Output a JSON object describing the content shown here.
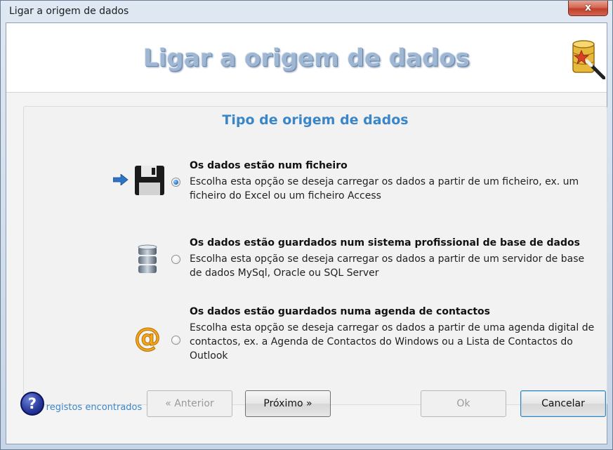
{
  "window": {
    "title": "Ligar a origem de dados",
    "close_symbol": "x"
  },
  "banner": {
    "title": "Ligar a origem de dados",
    "icon": "database-wizard-icon"
  },
  "section": {
    "title": "Tipo de origem de dados"
  },
  "options": [
    {
      "title": "Os dados estão num ficheiro",
      "description": "Escolha esta opção se deseja carregar os dados a partir de um ficheiro, ex. um ficheiro do Excel ou um ficheiro Access",
      "icon": "floppy-disk-icon",
      "selected": true
    },
    {
      "title": "Os dados estão guardados num sistema profissional de base de dados",
      "description": "Escolha esta opção se deseja carregar os dados a partir de um servidor de base de dados MySql, Oracle ou SQL Server",
      "icon": "database-icon",
      "selected": false
    },
    {
      "title": "Os dados estão guardados numa agenda de contactos",
      "description": "Escolha esta opção se deseja carregar os dados a partir de uma agenda digital de contactos, ex. a Agenda de Contactos do Windows ou a Lista de Contactos do Outlook",
      "icon": "at-sign-icon",
      "selected": false
    }
  ],
  "status": "11 registos encontrados",
  "buttons": {
    "help": "?",
    "previous": "« Anterior",
    "next": "Próximo »",
    "ok": "Ok",
    "cancel": "Cancelar"
  },
  "colors": {
    "accent": "#3a86c8",
    "banner_text": "#9fb7d3"
  }
}
